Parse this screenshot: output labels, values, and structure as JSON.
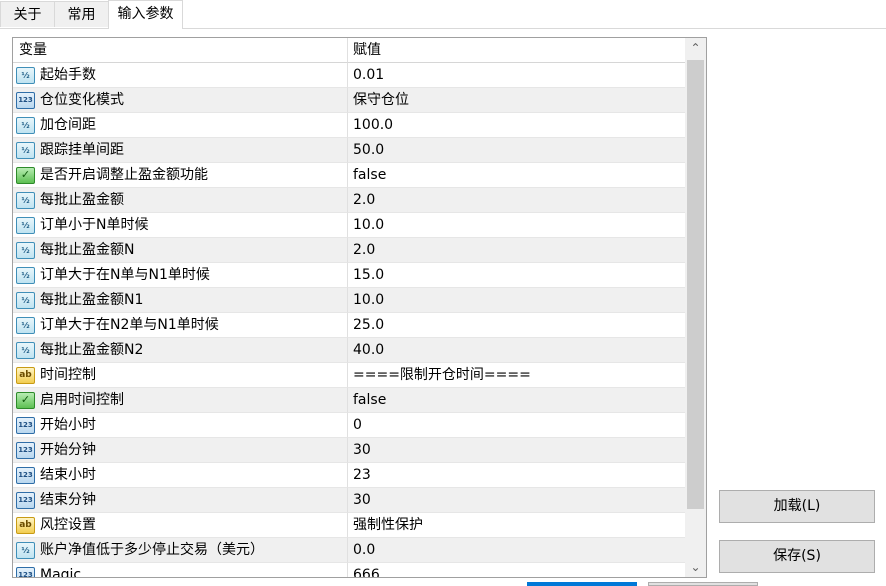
{
  "tabs": [
    {
      "label": "关于"
    },
    {
      "label": "常用"
    },
    {
      "label": "输入参数"
    }
  ],
  "table": {
    "headers": {
      "variable": "变量",
      "value": "赋值"
    },
    "rows": [
      {
        "icon": "double-icon",
        "icon_text": "½",
        "name": "起始手数",
        "value": "0.01"
      },
      {
        "icon": "int-icon",
        "icon_text": "123",
        "name": "仓位变化模式",
        "value": "保守仓位"
      },
      {
        "icon": "double-icon",
        "icon_text": "½",
        "name": "加仓间距",
        "value": "100.0"
      },
      {
        "icon": "double-icon",
        "icon_text": "½",
        "name": "跟踪挂单间距",
        "value": "50.0"
      },
      {
        "icon": "bool-icon",
        "icon_text": "✓",
        "name": "是否开启调整止盈金额功能",
        "value": "false"
      },
      {
        "icon": "double-icon",
        "icon_text": "½",
        "name": "每批止盈金额",
        "value": "2.0"
      },
      {
        "icon": "double-icon",
        "icon_text": "½",
        "name": "订单小于N单时候",
        "value": "10.0"
      },
      {
        "icon": "double-icon",
        "icon_text": "½",
        "name": "每批止盈金额N",
        "value": "2.0"
      },
      {
        "icon": "double-icon",
        "icon_text": "½",
        "name": "订单大于在N单与N1单时候",
        "value": "15.0"
      },
      {
        "icon": "double-icon",
        "icon_text": "½",
        "name": "每批止盈金额N1",
        "value": "10.0"
      },
      {
        "icon": "double-icon",
        "icon_text": "½",
        "name": "订单大于在N2单与N1单时候",
        "value": "25.0"
      },
      {
        "icon": "double-icon",
        "icon_text": "½",
        "name": "每批止盈金额N2",
        "value": "40.0"
      },
      {
        "icon": "string-icon",
        "icon_text": "ab",
        "name": "时间控制",
        "value": "====限制开仓时间===="
      },
      {
        "icon": "bool-icon",
        "icon_text": "✓",
        "name": "启用时间控制",
        "value": "false"
      },
      {
        "icon": "int-icon",
        "icon_text": "123",
        "name": "开始小时",
        "value": "0"
      },
      {
        "icon": "int-icon",
        "icon_text": "123",
        "name": "开始分钟",
        "value": "30"
      },
      {
        "icon": "int-icon",
        "icon_text": "123",
        "name": "结束小时",
        "value": "23"
      },
      {
        "icon": "int-icon",
        "icon_text": "123",
        "name": "结束分钟",
        "value": "30"
      },
      {
        "icon": "string-icon",
        "icon_text": "ab",
        "name": "风控设置",
        "value": "强制性保护"
      },
      {
        "icon": "double-icon",
        "icon_text": "½",
        "name": "账户净值低于多少停止交易（美元）",
        "value": "0.0"
      },
      {
        "icon": "int-icon",
        "icon_text": "123",
        "name": "Magic",
        "value": "666"
      }
    ]
  },
  "scrollbar": {
    "up_arrow": "⌃",
    "down_arrow": "⌄"
  },
  "buttons": {
    "load": "加载(L)",
    "save": "保存(S)"
  }
}
